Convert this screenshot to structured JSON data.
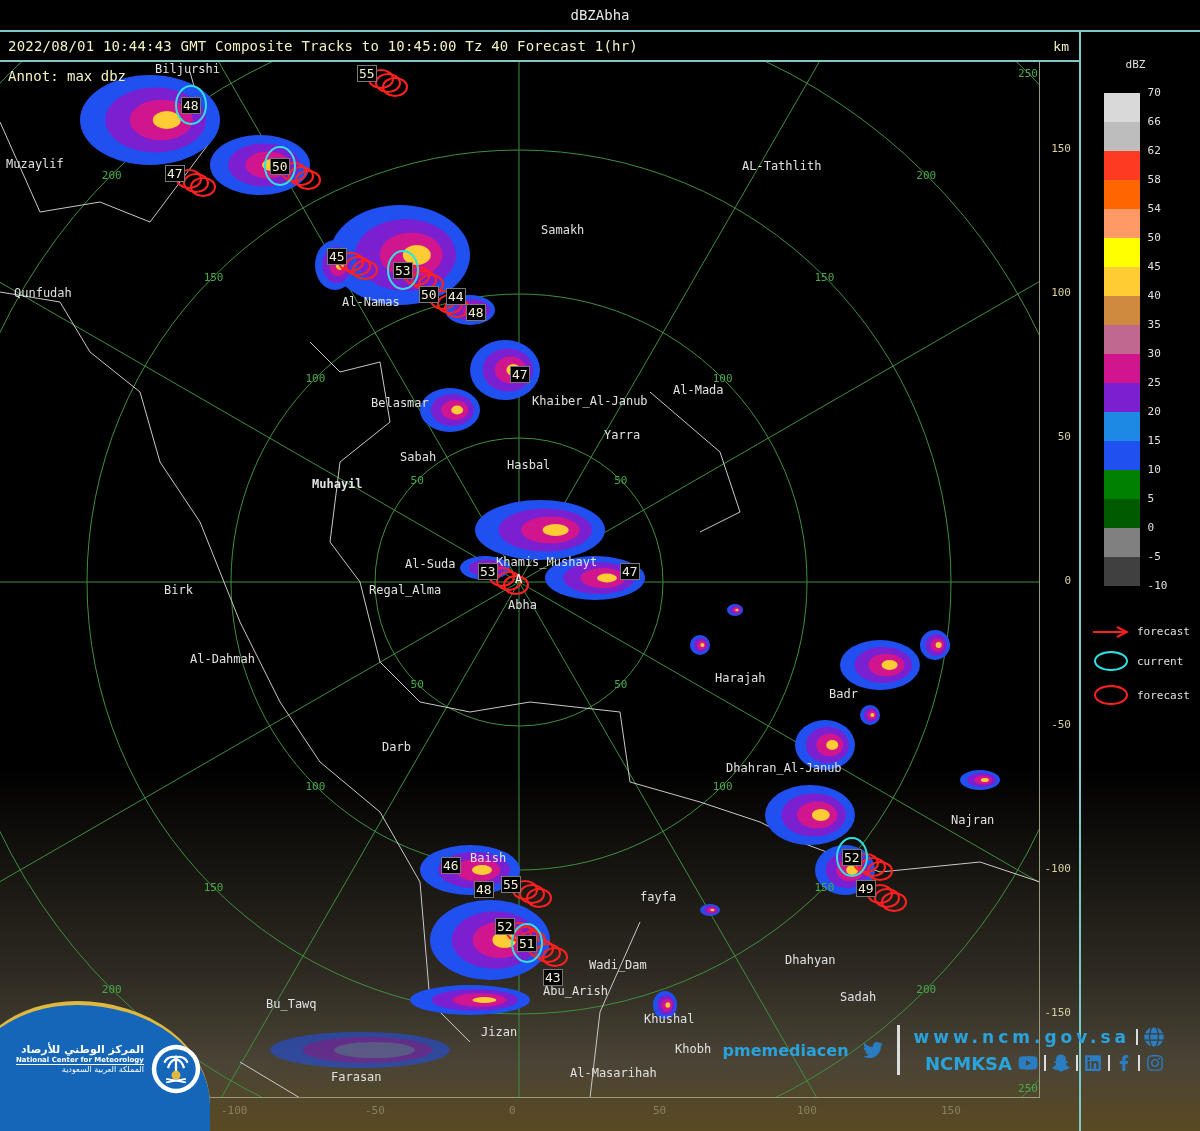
{
  "window": {
    "title": "dBZAbha"
  },
  "header": {
    "text": "2022/08/01 10:44:43 GMT Composite Tracks to 10:45:00 Tz 40 Forecast 1(hr)",
    "unit": "km"
  },
  "map": {
    "annotation": "Annot: max dbz",
    "radar_site": {
      "marker": "A",
      "name": "Abha"
    },
    "range_rings": [
      {
        "labels": [
          "50",
          "50",
          "50",
          "50"
        ]
      },
      {
        "labels": [
          "100",
          "100",
          "100",
          "100"
        ]
      },
      {
        "labels": [
          "150",
          "150",
          "150",
          "150"
        ]
      },
      {
        "labels": [
          "200",
          "200",
          "200",
          "200"
        ]
      },
      {
        "labels": [
          "250",
          "250"
        ]
      }
    ],
    "places": [
      {
        "name": "Biljurshi",
        "bold": false
      },
      {
        "name": "Muzaylif",
        "bold": false
      },
      {
        "name": "AL-Tathlith",
        "bold": false
      },
      {
        "name": "Samakh",
        "bold": false
      },
      {
        "name": "Qunfudah",
        "bold": false
      },
      {
        "name": "Al-Namas",
        "bold": false
      },
      {
        "name": "Belasmar",
        "bold": false
      },
      {
        "name": "Khaiber_Al-Janub",
        "bold": false
      },
      {
        "name": "Al-Mada",
        "bold": false
      },
      {
        "name": "Yarra",
        "bold": false
      },
      {
        "name": "Sabah",
        "bold": false
      },
      {
        "name": "Hasbal",
        "bold": false
      },
      {
        "name": "Muhayil",
        "bold": true
      },
      {
        "name": "Al-Suda",
        "bold": false
      },
      {
        "name": "Khamis_Mushayt",
        "bold": false
      },
      {
        "name": "Birk",
        "bold": false
      },
      {
        "name": "Regal_Alma",
        "bold": false
      },
      {
        "name": "Al-Dahmah",
        "bold": false
      },
      {
        "name": "Harajah",
        "bold": false
      },
      {
        "name": "Badr",
        "bold": false
      },
      {
        "name": "Darb",
        "bold": false
      },
      {
        "name": "Dhahran_Al-Janub",
        "bold": false
      },
      {
        "name": "Najran",
        "bold": false
      },
      {
        "name": "Baish",
        "bold": false
      },
      {
        "name": "fayfa",
        "bold": false
      },
      {
        "name": "Wadi_Dam",
        "bold": false
      },
      {
        "name": "Dhahyan",
        "bold": false
      },
      {
        "name": "Bu_Tawq",
        "bold": false
      },
      {
        "name": "Abu_Arish",
        "bold": false
      },
      {
        "name": "Sadah",
        "bold": false
      },
      {
        "name": "Khushal",
        "bold": false
      },
      {
        "name": "Jizan",
        "bold": false
      },
      {
        "name": "Khobh",
        "bold": false
      },
      {
        "name": "Farasan",
        "bold": false
      },
      {
        "name": "Al-Masarihah",
        "bold": false
      }
    ],
    "cells": [
      {
        "value": "55",
        "current": false,
        "forecast": true
      },
      {
        "value": "48",
        "current": true,
        "forecast": false
      },
      {
        "value": "47",
        "current": false,
        "forecast": true
      },
      {
        "value": "50",
        "current": true,
        "forecast": true
      },
      {
        "value": "45",
        "current": false,
        "forecast": true
      },
      {
        "value": "53",
        "current": true,
        "forecast": true
      },
      {
        "value": "50",
        "current": false,
        "forecast": true
      },
      {
        "value": "44",
        "current": false,
        "forecast": false
      },
      {
        "value": "48",
        "current": false,
        "forecast": false
      },
      {
        "value": "47",
        "current": false,
        "forecast": false
      },
      {
        "value": "47",
        "current": false,
        "forecast": false
      },
      {
        "value": "53",
        "current": false,
        "forecast": true
      },
      {
        "value": "46",
        "current": false,
        "forecast": false
      },
      {
        "value": "48",
        "current": false,
        "forecast": false
      },
      {
        "value": "55",
        "current": false,
        "forecast": true
      },
      {
        "value": "52",
        "current": false,
        "forecast": true
      },
      {
        "value": "51",
        "current": true,
        "forecast": true
      },
      {
        "value": "43",
        "current": false,
        "forecast": false
      },
      {
        "value": "52",
        "current": true,
        "forecast": true
      },
      {
        "value": "49",
        "current": false,
        "forecast": true
      }
    ],
    "y_ticks": [
      "150",
      "100",
      "50",
      "0",
      "-50",
      "-100",
      "-150"
    ],
    "x_ticks": [
      "-100",
      "-50",
      "0",
      "50",
      "100",
      "150"
    ]
  },
  "legend": {
    "title": "dBZ",
    "scale_labels": [
      "70",
      "66",
      "62",
      "58",
      "54",
      "50",
      "45",
      "40",
      "35",
      "30",
      "25",
      "20",
      "15",
      "10",
      "5",
      "0",
      "-5",
      "-10"
    ],
    "swatches": [
      {
        "color": "#d9d9d9"
      },
      {
        "color": "#bdbdbd"
      },
      {
        "color": "#ff3a22"
      },
      {
        "color": "#ff6600"
      },
      {
        "color": "#ff9966"
      },
      {
        "color": "#ffff00"
      },
      {
        "color": "#ffcc33"
      },
      {
        "color": "#d08a40"
      },
      {
        "color": "#c06890"
      },
      {
        "color": "#d0158f"
      },
      {
        "color": "#7a20d0"
      },
      {
        "color": "#1e88e5"
      },
      {
        "color": "#2050f0"
      },
      {
        "color": "#008000"
      },
      {
        "color": "#005a00"
      },
      {
        "color": "#808080"
      },
      {
        "color": "#404040"
      }
    ],
    "items": [
      {
        "kind": "arrow",
        "label": "forecast"
      },
      {
        "kind": "current",
        "label": "current"
      },
      {
        "kind": "forecast",
        "label": "forecast"
      }
    ]
  },
  "branding": {
    "name_ar": "المركز الوطني للأرصاد",
    "name_en": "National Center for Meteorology",
    "country_ar": "المملكة العربية السعودية",
    "twitter": "pmemediacen",
    "website": "www.ncm.gov.sa",
    "handle": "NCMKSA"
  }
}
